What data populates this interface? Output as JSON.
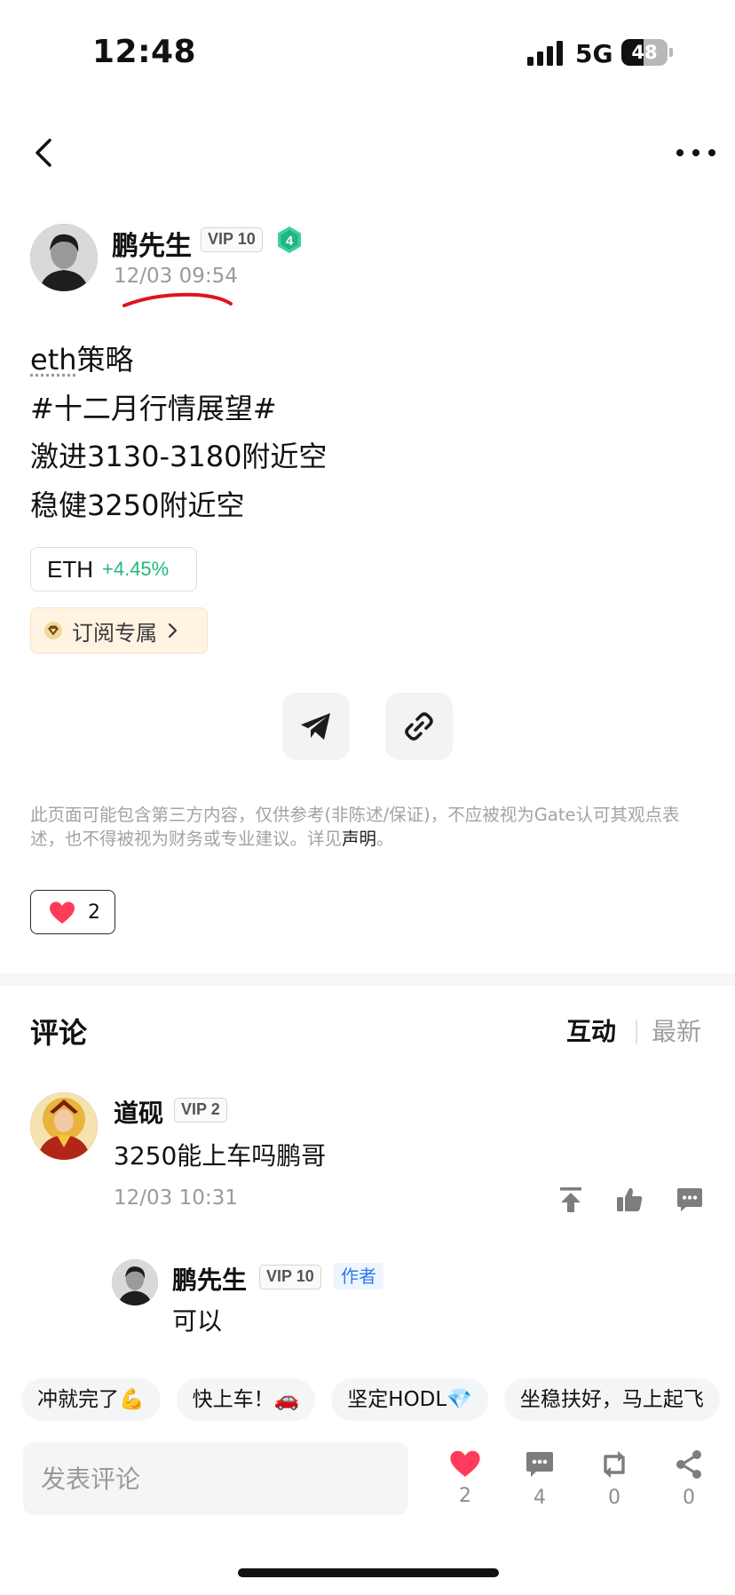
{
  "status_bar": {
    "time": "12:48",
    "network": "5G",
    "battery": "48",
    "battery_level": 0.48
  },
  "post": {
    "author": {
      "name": "鹏先生",
      "vip": "VIP 10",
      "level": "4",
      "timestamp": "12/03 09:54"
    },
    "lines": {
      "line1_eth": "eth",
      "line1_rest": "策略",
      "line2": "#十二月行情展望#",
      "line3": "激进3130-3180附近空",
      "line4": "稳健3250附近空"
    },
    "ticker": {
      "symbol": "ETH",
      "change": "+4.45%"
    },
    "subscription_label": "订阅专属",
    "disclaimer": {
      "text": "此页面可能包含第三方内容，仅供参考(非陈述/保证)，不应被视为Gate认可其观点表述，也不得被视为财务或专业建议。详见",
      "link": "声明",
      "end": "。"
    },
    "like_count": "2"
  },
  "comments_section": {
    "title": "评论",
    "sort_hot": "互动",
    "sort_new": "最新",
    "items": [
      {
        "name": "道砚",
        "vip": "VIP 2",
        "text": "3250能上车吗鹏哥",
        "time": "12/03 10:31",
        "reply": {
          "name": "鹏先生",
          "vip": "VIP 10",
          "tag": "作者",
          "text": "可以"
        }
      }
    ]
  },
  "quick_replies": [
    "冲就完了💪",
    "快上车！🚗",
    "坚定HODL💎",
    "坐稳扶好，马上起飞"
  ],
  "bottom_bar": {
    "input_placeholder": "发表评论",
    "likes": "2",
    "comments": "4",
    "reposts": "0",
    "shares": "0"
  },
  "colors": {
    "accent_green": "#22b77a",
    "like_red": "#ff3b5c",
    "author_tag_blue": "#2f7be8",
    "subscription_bg": "#fff4e2"
  },
  "icons": [
    "back-arrow-icon",
    "more-icon",
    "level-badge-icon",
    "telegram-icon",
    "link-icon",
    "diamond-icon",
    "chevron-right-icon",
    "heart-icon",
    "pin-top-icon",
    "thumbs-up-icon",
    "reply-icon",
    "comment-icon",
    "repost-icon",
    "share-icon"
  ]
}
